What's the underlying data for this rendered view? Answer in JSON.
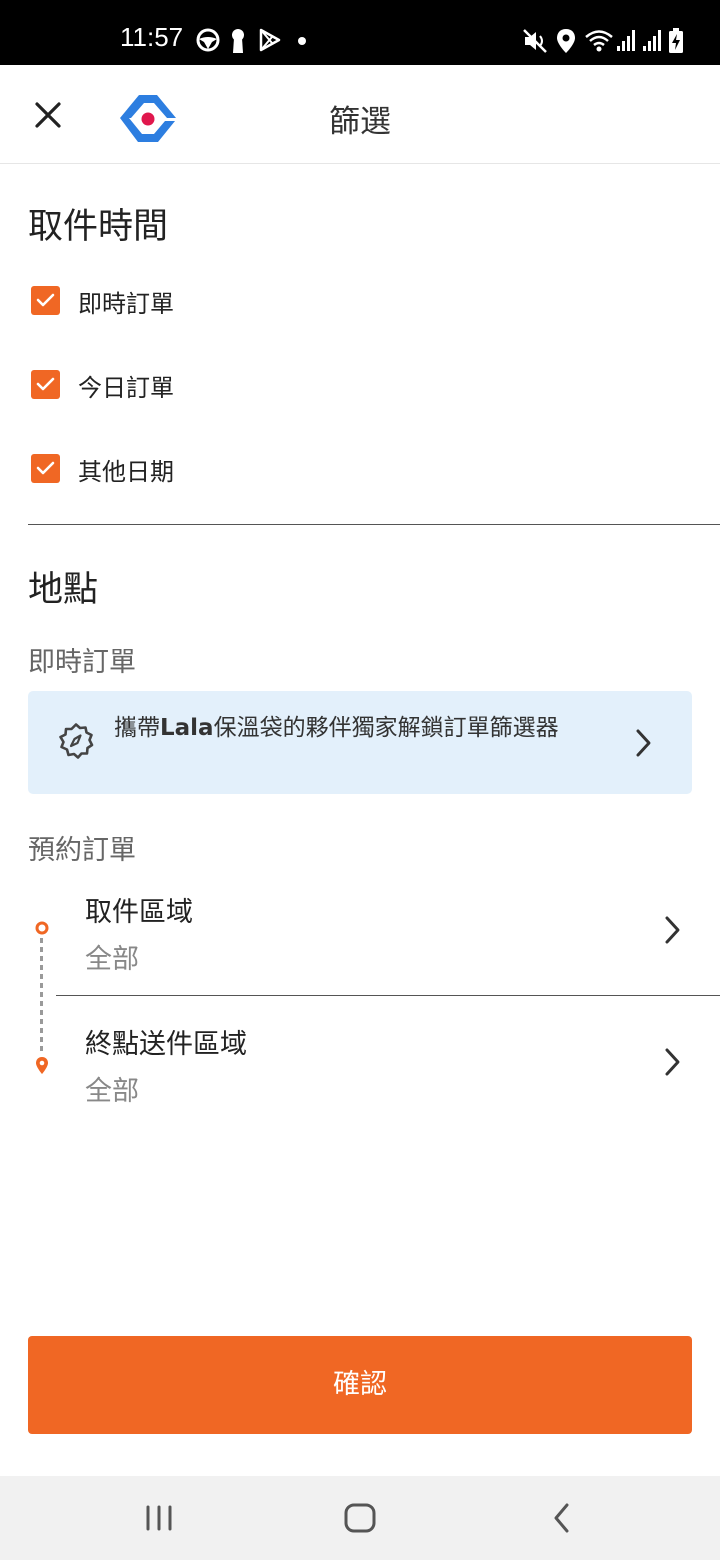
{
  "status_bar": {
    "time": "11:57",
    "left_icons": [
      "steering-wheel-icon",
      "keyhole-icon",
      "play-store-icon",
      "dot-icon"
    ],
    "right_icons": [
      "mute-icon",
      "location-icon",
      "wifi-icon",
      "signal-icon",
      "signal-icon",
      "battery-charging-icon"
    ]
  },
  "header": {
    "title": "篩選",
    "close_icon": "close-icon",
    "logo": "app-logo"
  },
  "pickup_time": {
    "title": "取件時間",
    "options": [
      {
        "label": "即時訂單",
        "checked": true
      },
      {
        "label": "今日訂單",
        "checked": true
      },
      {
        "label": "其他日期",
        "checked": true
      }
    ]
  },
  "location": {
    "title": "地點",
    "instant_heading": "即時訂單",
    "banner_text": "攜帶Lala保溫袋的夥伴獨家解鎖訂單篩選器",
    "scheduled_heading": "預約訂單",
    "pickup_area": {
      "title": "取件區域",
      "value": "全部"
    },
    "dropoff_area": {
      "title": "終點送件區域",
      "value": "全部"
    }
  },
  "confirm_label": "確認",
  "colors": {
    "accent": "#f06724",
    "banner_bg": "#e3f0fb",
    "logo_blue": "#2d7ee0",
    "logo_red": "#e0174d"
  }
}
